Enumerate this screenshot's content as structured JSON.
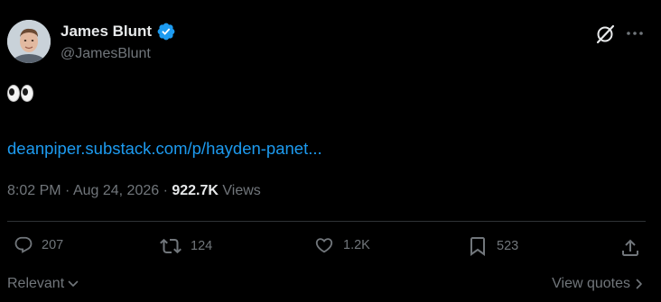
{
  "author": {
    "display_name": "James Blunt",
    "handle": "@JamesBlunt",
    "verified": true
  },
  "tweet": {
    "emoji": "👀",
    "link_text": "deanpiper.substack.com/p/hayden-panet...",
    "time": "8:02 PM",
    "separator1": " · ",
    "date": "Aug 24, 2026",
    "separator2": " · ",
    "views_count": "922.7K",
    "views_label": " Views"
  },
  "actions": {
    "replies": "207",
    "reposts": "124",
    "likes": "1.2K",
    "bookmarks": "523"
  },
  "footer": {
    "sort_label": "Relevant",
    "view_quotes_label": "View quotes"
  },
  "colors": {
    "background": "#000000",
    "text_primary": "#e7e9ea",
    "text_secondary": "#71767b",
    "link": "#1d9bf0",
    "verified_badge": "#1d9bf0",
    "divider": "#2f3336"
  },
  "icons": {
    "header": [
      "grok-icon",
      "more-options-icon"
    ],
    "verified": "verified-badge-icon",
    "actions": [
      "reply-icon",
      "repost-icon",
      "like-icon",
      "bookmark-icon",
      "share-icon"
    ],
    "footer": [
      "chevron-down-icon",
      "chevron-right-icon"
    ]
  }
}
